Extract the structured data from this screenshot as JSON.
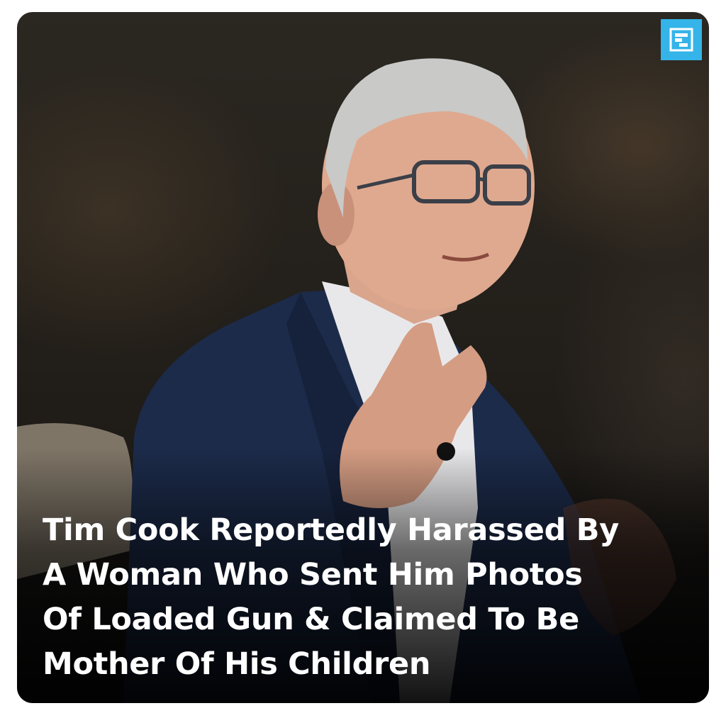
{
  "headline": {
    "line1": "Tim Cook Reportedly Harassed By",
    "line2": "A Woman Who Sent Him Photos",
    "line3": "Of Loaded Gun & Claimed To Be",
    "line4": "Mother Of His Children"
  },
  "brand": {
    "logo_icon": "brand-logo-icon",
    "accent_color": "#34b4e8"
  },
  "photo": {
    "subject_icon": "speaker-photo"
  }
}
